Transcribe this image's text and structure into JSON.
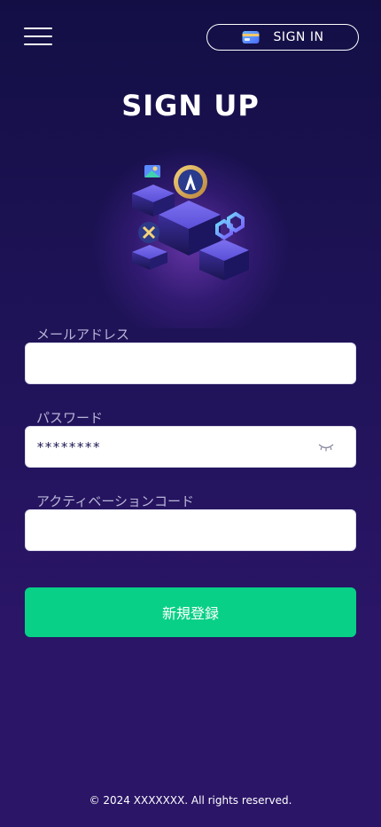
{
  "header": {
    "menu_icon": "hamburger-menu-icon",
    "signin": {
      "label": "SIGN IN",
      "icon": "wallet-icon"
    }
  },
  "page": {
    "title": "SIGN UP",
    "hero_image": "blockchain-cubes-illustration"
  },
  "form": {
    "email": {
      "label": "メールアドレス",
      "value": ""
    },
    "password": {
      "label": "パスワード",
      "value": "********",
      "toggle_icon": "eye-closed-icon"
    },
    "activation": {
      "label": "アクティベーションコード",
      "value": ""
    },
    "submit_label": "新規登録"
  },
  "footer": {
    "copyright": "© 2024 XXXXXXX. All rights reserved."
  },
  "colors": {
    "background_top": "#130f45",
    "background_bottom": "#2b1567",
    "accent_green": "#08d086",
    "label_text": "#b9b6d8",
    "cube_purple": "#5b4fd6"
  }
}
